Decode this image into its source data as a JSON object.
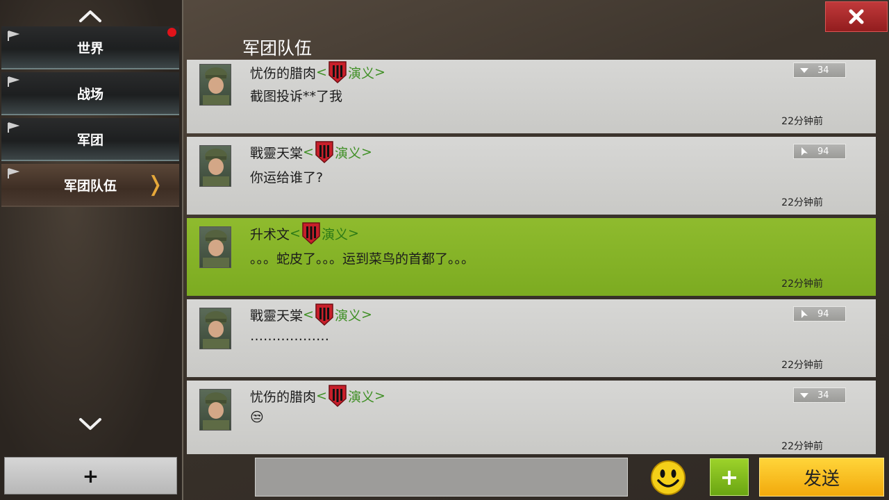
{
  "sidebar": {
    "items": [
      {
        "label": "世界",
        "has_notification": true
      },
      {
        "label": "战场"
      },
      {
        "label": "军团"
      },
      {
        "label": "军团队伍",
        "active": true
      }
    ],
    "add_label": "+"
  },
  "header": {
    "title": "军团队伍",
    "close_icon": "close-icon"
  },
  "messages": [
    {
      "name": "忧伤的腊肉",
      "legion": "演义",
      "text": "截图投诉**了我",
      "time": "22分钟前",
      "rank": "34",
      "rank_icon": "down-chevron-rank-icon",
      "highlight": false
    },
    {
      "name": "戰靈天棠",
      "legion": "演义",
      "text": "你运给谁了?",
      "time": "22分钟前",
      "rank": "94",
      "rank_icon": "arrow-rank-icon",
      "highlight": false
    },
    {
      "name": "升术文",
      "legion": "演义",
      "text": "。。。蛇皮了。。。运到菜鸟的首都了。。。",
      "time": "22分钟前",
      "rank": "",
      "highlight": true
    },
    {
      "name": "戰靈天棠",
      "legion": "演义",
      "text": "………………",
      "time": "22分钟前",
      "rank": "94",
      "rank_icon": "arrow-rank-icon",
      "highlight": false
    },
    {
      "name": "忧伤的腊肉",
      "legion": "演义",
      "text": "😒",
      "time": "22分钟前",
      "rank": "34",
      "rank_icon": "down-chevron-rank-icon",
      "highlight": false
    }
  ],
  "composer": {
    "input_value": "",
    "input_placeholder": "",
    "emoji_icon": "smiley-icon",
    "plus_label": "+",
    "send_label": "发送"
  },
  "colors": {
    "highlight_row": "#86b527",
    "legion_text": "#3f8f25",
    "send_button": "#f7c21f",
    "close_button": "#a8292a"
  }
}
